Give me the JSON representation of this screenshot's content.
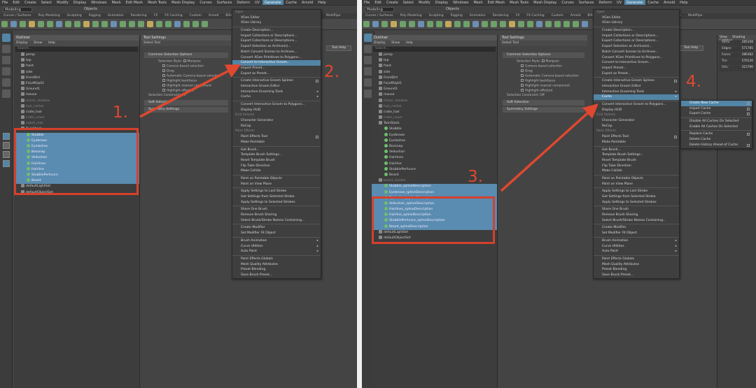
{
  "colors": {
    "accent": "#5285a6",
    "annotation": "#d5402c",
    "selection": "#5a8bb0"
  },
  "menubar": [
    "File",
    "Edit",
    "Create",
    "Select",
    "Modify",
    "Display",
    "Windows",
    "Mesh",
    "Edit Mesh",
    "Mesh Tools",
    "Mesh Display",
    "Curves",
    "Surfaces",
    "Deform",
    "UV",
    "Generate",
    "Cache",
    "Arnold",
    "Help"
  ],
  "menubar_active": "Generate",
  "mode_select": "Modeling",
  "objects_label": "Objects",
  "shelf_tabs": [
    "Curves / Surfaces",
    "Poly Modeling",
    "Sculpting",
    "Rigging",
    "Animation",
    "Rendering",
    "FX",
    "FX Caching",
    "Custom",
    "Arnold",
    "Bifrost",
    "MASH",
    "Motion Graphics",
    "XGen",
    "TURTLE",
    "MultiPipe"
  ],
  "outliner": {
    "title": "Outliner",
    "menu": [
      "Display",
      "Show",
      "Help"
    ],
    "search_placeholder": "Search..."
  },
  "panel1": {
    "items": [
      "persp",
      "top",
      "front",
      "side",
      "FrontDirt",
      "FxLeftUp01",
      "Ground1",
      "mouse",
      "mirror_shadow",
      "hair_rachel",
      "crate_hair",
      "crate_cover",
      "cube1_hair",
      "TwinStack",
      "Stubble",
      "Eyebrows",
      "Eyelashes",
      "Bossnap",
      "Vellushair",
      "Hairlines",
      "Hairline",
      "StubblePerhcure",
      "Beard",
      "defaultLightSet",
      "defaultObjectSet"
    ],
    "selected_from": 14,
    "selected_to": 22,
    "annotation_1": "1.",
    "annotation_2": "2."
  },
  "panel2": {
    "items": [
      "persp",
      "top",
      "front",
      "side",
      "FrontDirt",
      "FxLeftUp01",
      "Ground1",
      "mouse",
      "mirror_shadow",
      "hair_rachel",
      "crate_hair",
      "crate_cover",
      "TwinStack",
      "Stubble",
      "Eyebrows",
      "Eyelashes",
      "Bossnap",
      "Vellushair",
      "Hairlines",
      "Hairline",
      "StubblePerhcure",
      "Beard",
      "beard_Guides",
      "Stubble_splineDescription",
      "Eyebrows_splineDescription",
      "Eyelashes_splineDescription",
      "Vellushair_splineDescription",
      "Hairlines_splineDescription",
      "Hairline_splineDescription",
      "StubblePerhcure_splineDescription",
      "Beard_splineDescription",
      "defaultLightSet",
      "defaultObjectSet"
    ],
    "selected_from": 23,
    "selected_to": 30,
    "annotation_3": "3.",
    "annotation_4": "4."
  },
  "tool_settings": {
    "title": "Tool Settings",
    "tool": "Select Tool",
    "tool_help": "Tool Help",
    "section": "Common Selection Options",
    "selection_style_label": "Selection Style:",
    "selection_style_value": "Marquee",
    "rows": [
      "Camera based selection",
      "Drag",
      "Automatic Camera based selection",
      "Highlight backfaces",
      "Highlight nearest component",
      "Highlight effected"
    ],
    "selection_constraint_label": "Selection Constraint:",
    "selection_constraint_value": "Off",
    "soft_selection": "Soft Selection",
    "symmetry": "Symmetry Settings"
  },
  "generate_menu": {
    "items": [
      {
        "label": "Xgen",
        "type": "hdr"
      },
      {
        "label": "XGen Editor"
      },
      {
        "label": "XGen Library"
      },
      {
        "label": "",
        "type": "sep"
      },
      {
        "label": "Create Description..."
      },
      {
        "label": "Import Collections or Descriptions..."
      },
      {
        "label": "Export Collections or Descriptions..."
      },
      {
        "label": "Export Selection as Archive(s)..."
      },
      {
        "label": "Batch Convert Scenes to Archives..."
      },
      {
        "label": "Convert XGen Primitives to Polygons..."
      },
      {
        "label": "Convert to Interactive Groom..."
      },
      {
        "label": "Import Preset..."
      },
      {
        "label": "Export as Preset..."
      },
      {
        "label": "",
        "type": "sep"
      },
      {
        "label": "Create Interactive Groom Splines",
        "box": true
      },
      {
        "label": "Interactive Groom Editor"
      },
      {
        "label": "Interactive Grooming Tools",
        "arrow": true
      },
      {
        "label": "Cache",
        "arrow": true
      },
      {
        "label": "",
        "type": "sep"
      },
      {
        "label": "Convert Interactive Groom to Polygons..."
      },
      {
        "label": "Display HUD"
      },
      {
        "label": "Grid Selects",
        "type": "hdr"
      },
      {
        "label": "Character Generator"
      },
      {
        "label": "ReCap"
      },
      {
        "label": "Paint Effects",
        "type": "hdr"
      },
      {
        "label": "Paint Effects Tool",
        "box": true
      },
      {
        "label": "Make Paintable"
      },
      {
        "label": "",
        "type": "sep"
      },
      {
        "label": "Get Brush..."
      },
      {
        "label": "Template Brush Settings..."
      },
      {
        "label": "Reset Template Brush"
      },
      {
        "label": "Flip Tube Direction"
      },
      {
        "label": "Make Collide"
      },
      {
        "label": "",
        "type": "sep"
      },
      {
        "label": "Paint on Paintable Objects"
      },
      {
        "label": "Paint on View Plane"
      },
      {
        "label": "",
        "type": "sep"
      },
      {
        "label": "Apply Settings to Last Stroke"
      },
      {
        "label": "Get Settings from Selected Stroke"
      },
      {
        "label": "Apply Settings to Selected Strokes"
      },
      {
        "label": "",
        "type": "sep"
      },
      {
        "label": "Share One Brush"
      },
      {
        "label": "Remove Brush Sharing"
      },
      {
        "label": "Select Brush/Stroke Names Containing..."
      },
      {
        "label": "",
        "type": "sep"
      },
      {
        "label": "Create Modifier"
      },
      {
        "label": "Set Modifier Fit Object"
      },
      {
        "label": "",
        "type": "sep"
      },
      {
        "label": "Brush Animation",
        "arrow": true
      },
      {
        "label": "Curve Utilities",
        "arrow": true
      },
      {
        "label": "Auto Paint",
        "arrow": true
      },
      {
        "label": "",
        "type": "sep"
      },
      {
        "label": "Paint Effects Globals"
      },
      {
        "label": "Mesh Quality Attributes"
      },
      {
        "label": "Preset Blending"
      },
      {
        "label": "Save Brush Preset..."
      }
    ],
    "highlight_panel1": "Convert to Interactive Groom...",
    "highlight_panel2": "Cache"
  },
  "cache_submenu": {
    "items": [
      {
        "label": "Create New Cache",
        "box": true,
        "hl": true
      },
      {
        "label": "Import Cache",
        "box": true
      },
      {
        "label": "Export Cache",
        "box": true
      },
      {
        "label": "",
        "type": "sep"
      },
      {
        "label": "Disable All Caches On Selected"
      },
      {
        "label": "Enable All Caches On Selected"
      },
      {
        "label": "",
        "type": "sep"
      },
      {
        "label": "Replace Cache",
        "box": true
      },
      {
        "label": "Delete Cache"
      },
      {
        "label": "Delete History Ahead of Cache",
        "box": true
      }
    ]
  },
  "attr_editor": {
    "tabs": [
      "View",
      "Shading",
      "Lighting"
    ],
    "rows": [
      {
        "label": "Verts:",
        "value": "285108"
      },
      {
        "label": "Edges:",
        "value": "571785"
      },
      {
        "label": "Faces:",
        "value": "286382"
      },
      {
        "label": "Tris:",
        "value": "570126"
      },
      {
        "label": "UVs:",
        "value": "315790"
      }
    ]
  }
}
